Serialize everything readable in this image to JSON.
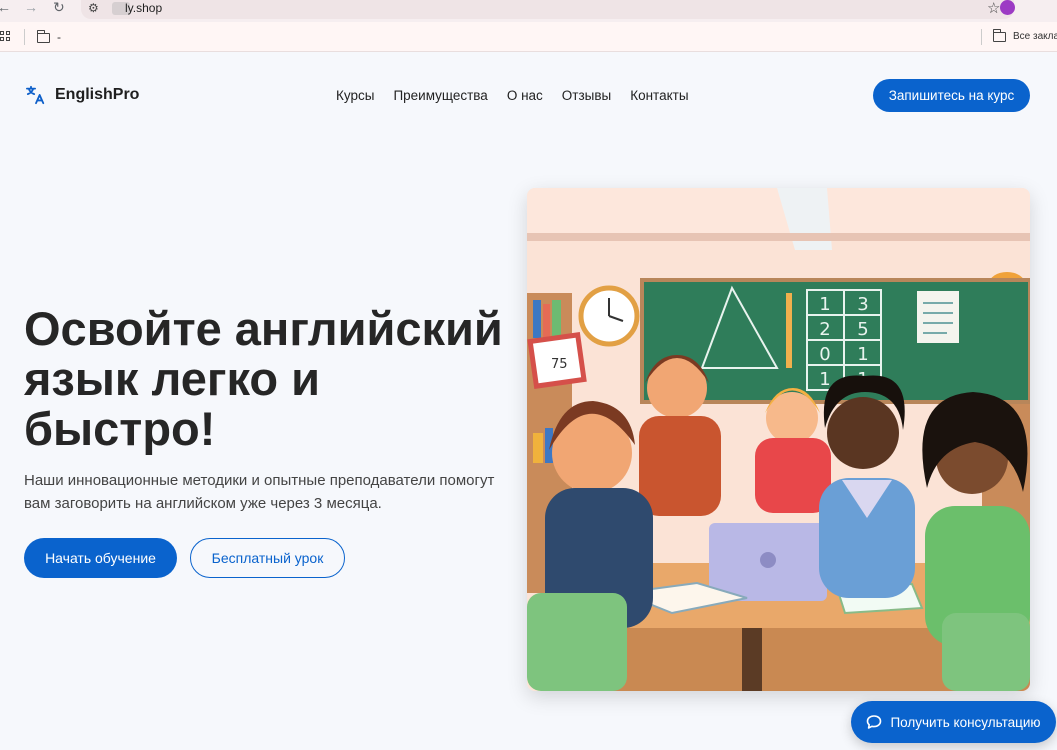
{
  "browser": {
    "url": "ly.shop",
    "bookmark_folder_label": "-",
    "all_bookmarks_label": "Все заклад"
  },
  "site": {
    "logo": "EnglishPro",
    "nav": [
      "Курсы",
      "Преимущества",
      "О нас",
      "Отзывы",
      "Контакты"
    ],
    "cta_top": "Запишитесь на курс"
  },
  "hero": {
    "title": "Освойте английский язык легко и быстро!",
    "subtitle": "Наши инновационные методики и опытные преподаватели помогут вам заговорить на английском уже через 3 месяца.",
    "primary_button": "Начать обучение",
    "secondary_button": "Бесплатный урок"
  },
  "illustration": {
    "poster_number": "75",
    "board_numbers": [
      "1",
      "3",
      "2",
      "5",
      "0",
      "1",
      "1",
      "1"
    ]
  },
  "consult_button": "Получить консультацию",
  "colors": {
    "accent": "#0a63cd",
    "title": "#262626",
    "page_background": "#f6f8fc"
  }
}
